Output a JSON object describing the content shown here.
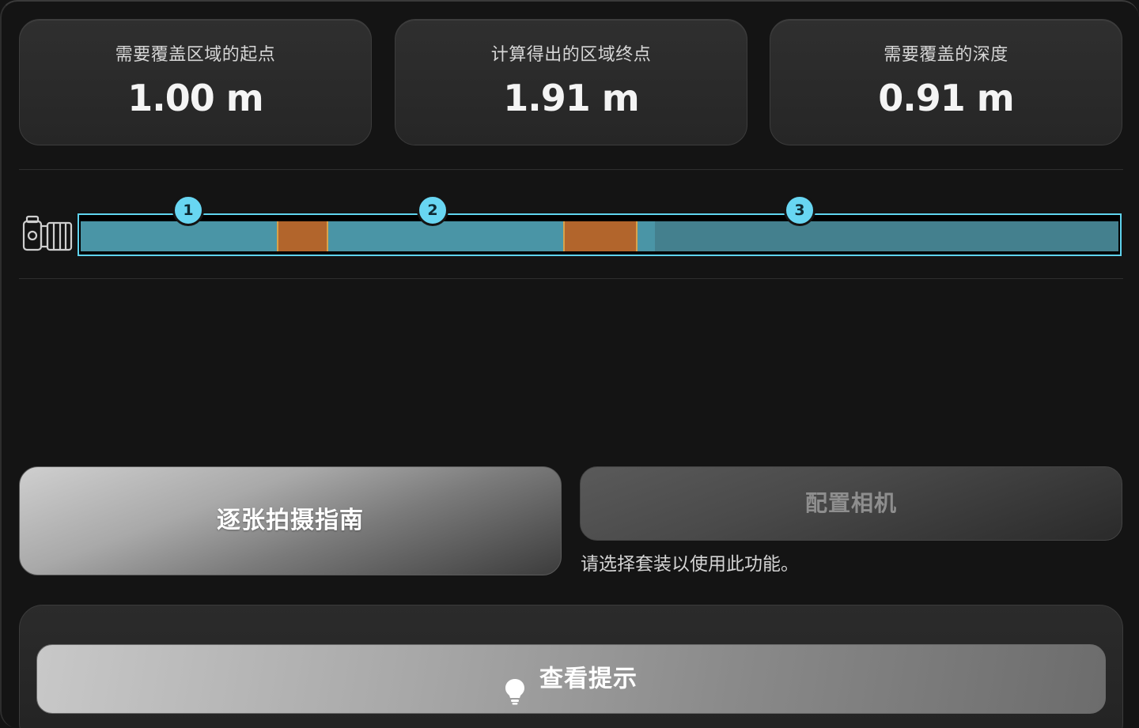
{
  "stats": {
    "start": {
      "label": "需要覆盖区域的起点",
      "value": "1.00 m"
    },
    "end": {
      "label": "计算得出的区域终点",
      "value": "1.91 m"
    },
    "depth": {
      "label": "需要覆盖的深度",
      "value": "0.91 m"
    }
  },
  "strip": {
    "markers": [
      "1",
      "2",
      "3"
    ],
    "colors": {
      "border": "#5fd3ee",
      "shot": "#4a95a6",
      "shot_faded": "#44808e",
      "overlap": "#b2652c",
      "marker": "#68d6f2"
    },
    "camera_icon": "camera-side-icon"
  },
  "actions": {
    "guide_label": "逐张拍摄指南",
    "config_label": "配置相机",
    "config_note": "请选择套装以使用此功能。",
    "hint_label": "查看提示",
    "hint_icon": "lightbulb-icon"
  }
}
